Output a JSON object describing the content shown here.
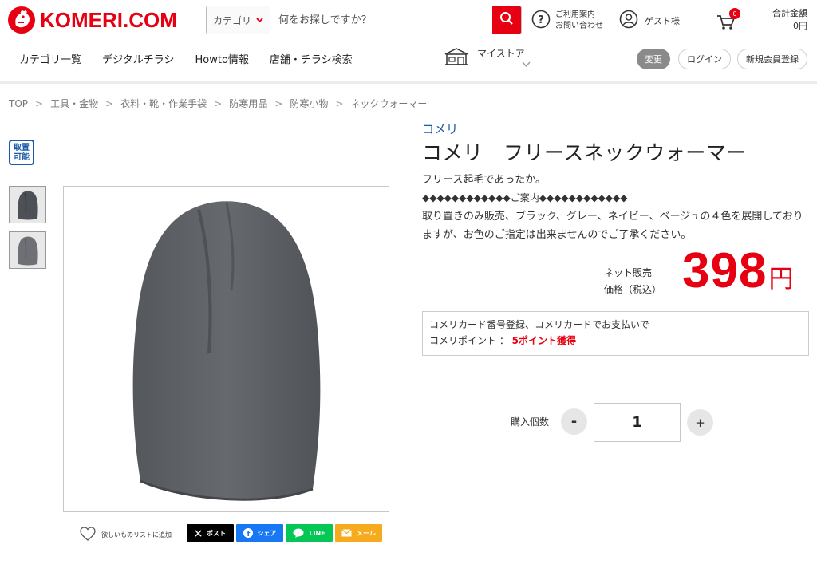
{
  "header": {
    "logo_text": "KOMERI.COM",
    "search": {
      "category_label": "カテゴリ",
      "placeholder": "何をお探しですか？"
    },
    "help": {
      "line1": "ご利用案内",
      "line2": "お問い合わせ"
    },
    "guest_label": "ゲスト様",
    "cart_count": "0",
    "total": {
      "label": "合計金額",
      "value": "0円"
    }
  },
  "nav": {
    "items": [
      "カテゴリ一覧",
      "デジタルチラシ",
      "Howto情報",
      "店舗・チラシ検索"
    ],
    "mystore_label": "マイストア",
    "change_label": "変更",
    "login_label": "ログイン",
    "register_label": "新規会員登録"
  },
  "breadcrumb": [
    "TOP",
    "工具・金物",
    "衣料・靴・作業手袋",
    "防寒用品",
    "防寒小物",
    "ネックウォーマー"
  ],
  "gallery": {
    "pickup_badge": [
      "取置",
      "可能"
    ],
    "wishlist_label": "欲しいものリストに追加",
    "share": {
      "x_label": "ポスト",
      "facebook_label": "シェア",
      "line_label": "LINE",
      "mail_label": "メール"
    }
  },
  "product": {
    "brand": "コメリ",
    "title": "コメリ　フリースネックウォーマー",
    "desc1": "フリース起毛であったか。",
    "desc2": "◆◆◆◆◆◆◆◆◆◆◆◆ご案内◆◆◆◆◆◆◆◆◆◆◆◆",
    "desc3": "取り置きのみ販売、ブラック、グレー、ネイビー、ベージュの４色を展開しておりますが、お色のご指定は出来ませんのでご了承ください。",
    "price_label1": "ネット販売",
    "price_label2": "価格（税込）",
    "price": "398",
    "price_unit": "円",
    "points_line1": "コメリカード番号登録、コメリカードでお支払いで",
    "points_prefix": "コメリポイント ： ",
    "points_value": "5ポイント獲得",
    "qty_label": "購入個数",
    "qty_minus": "-",
    "qty_value": "1",
    "qty_plus": "+"
  },
  "colors": {
    "brand_red": "#e60012",
    "link_blue": "#1a5aa8"
  }
}
